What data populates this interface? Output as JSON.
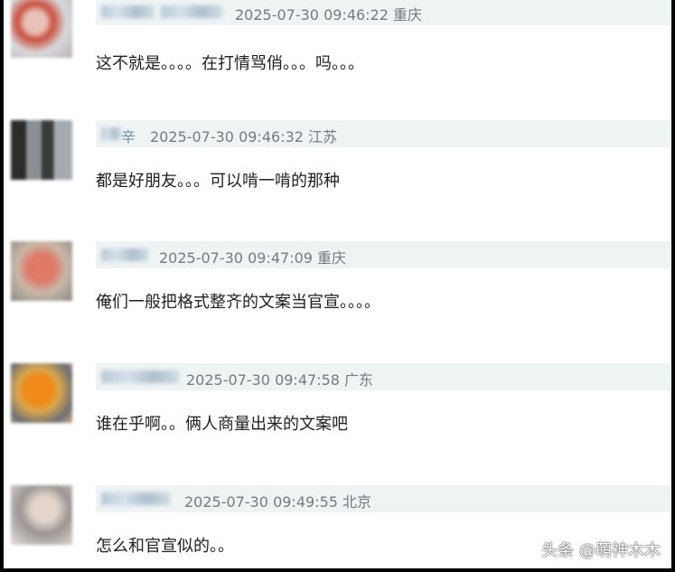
{
  "comments": [
    {
      "meta": "2025-07-30 09:46:22 重庆",
      "text": "这不就是。。。。在打情骂俏。。。吗。。。",
      "name_tail": ""
    },
    {
      "meta": "2025-07-30 09:46:32 江苏",
      "text": "都是好朋友。。。可以啃一啃的那种",
      "name_tail": "辛"
    },
    {
      "meta": "2025-07-30 09:47:09 重庆",
      "text": "俺们一般把格式整齐的文案当官宣。。。。",
      "name_tail": ""
    },
    {
      "meta": "2025-07-30 09:47:58 广东",
      "text": "谁在乎啊。。俩人商量出来的文案吧",
      "name_tail": ""
    },
    {
      "meta": "2025-07-30 09:49:55 北京",
      "text": "怎么和官宣似的。。",
      "name_tail": ""
    }
  ],
  "watermark": "头条 @萌神木木"
}
